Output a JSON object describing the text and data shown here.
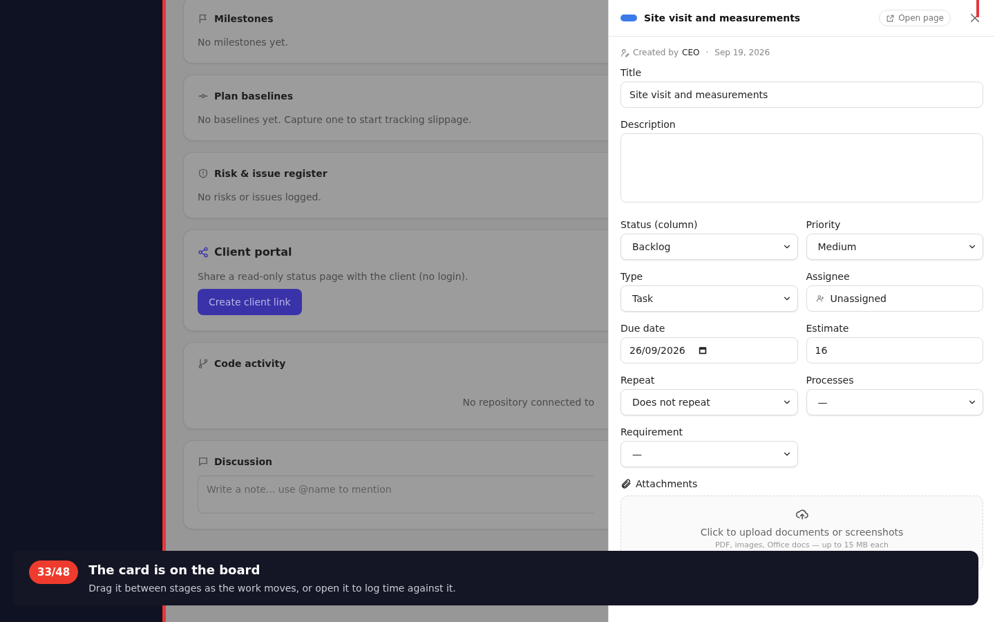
{
  "main": {
    "cards": [
      {
        "kind": "milestones",
        "title": "Milestones",
        "body": "No milestones yet."
      },
      {
        "kind": "baselines",
        "title": "Plan baselines",
        "body": "No baselines yet. Capture one to start tracking slippage."
      },
      {
        "kind": "risks",
        "title": "Risk & issue register",
        "body": "No risks or issues logged."
      },
      {
        "kind": "client_portal",
        "title": "Client portal",
        "body": "Share a read-only status page with the client (no login).",
        "button": "Create client link"
      },
      {
        "kind": "code",
        "title": "Code activity",
        "body": "No repository connected to"
      },
      {
        "kind": "discussion",
        "title": "Discussion",
        "placeholder": "Write a note... use @name to mention"
      }
    ]
  },
  "drawer": {
    "title": "Site visit and measurements",
    "open_page": "Open page",
    "meta": {
      "created_by": "Created by",
      "creator": "CEO",
      "separator": "·",
      "date": "Sep 19, 2026"
    },
    "title_field": {
      "label": "Title",
      "value": "Site visit and measurements"
    },
    "description": {
      "label": "Description"
    },
    "fields": [
      {
        "label": "Status (column)",
        "kind": "select",
        "value": "Backlog"
      },
      {
        "label": "Priority",
        "kind": "select",
        "value": "Medium"
      },
      {
        "label": "Type",
        "kind": "select",
        "value": "Task"
      },
      {
        "label": "Assignee",
        "kind": "person",
        "value": "Unassigned"
      },
      {
        "label": "Due date",
        "kind": "date",
        "value": "26/09/2026"
      },
      {
        "label": "Estimate",
        "kind": "text",
        "value": "16"
      },
      {
        "label": "Repeat",
        "kind": "select",
        "value": "Does not repeat"
      },
      {
        "label": "Processes",
        "kind": "select",
        "value": "—"
      },
      {
        "label": "Requirement",
        "kind": "select",
        "value": "—"
      }
    ],
    "attachments": {
      "label": "Attachments",
      "upload": "Click to upload documents or screenshots",
      "hint": "PDF, images, Office docs — up to 15 MB each"
    }
  },
  "toast": {
    "step": "33/48",
    "title": "The card is on the board",
    "body": "Drag it between stages as the work moves, or open it to log time against it."
  }
}
